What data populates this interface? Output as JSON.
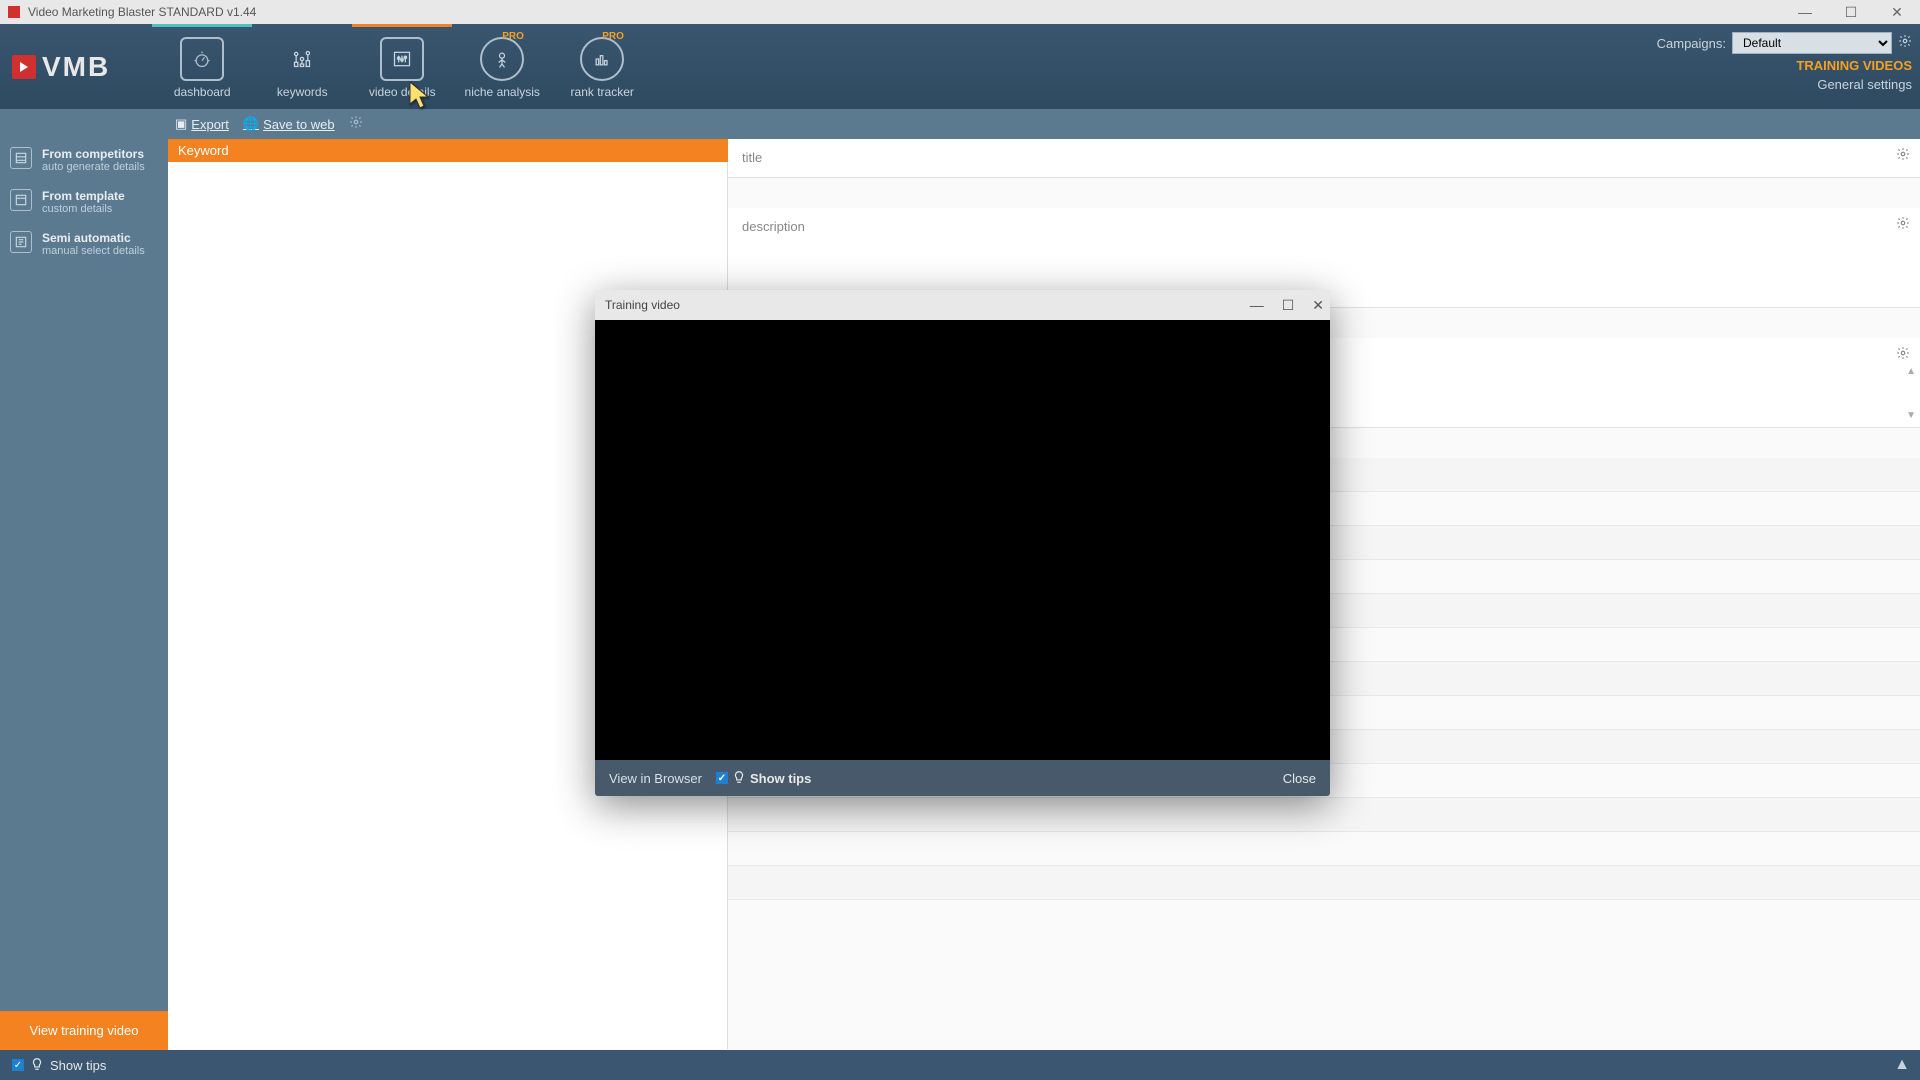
{
  "window": {
    "title": "Video Marketing Blaster STANDARD v1.44"
  },
  "logo": {
    "text": "VMB"
  },
  "nav": {
    "tabs": [
      {
        "label": "dashboard",
        "pro": false
      },
      {
        "label": "keywords",
        "pro": false
      },
      {
        "label": "video details",
        "pro": false
      },
      {
        "label": "niche analysis",
        "pro": true
      },
      {
        "label": "rank tracker",
        "pro": true
      }
    ],
    "pro_badge": "PRO"
  },
  "campaigns": {
    "label": "Campaigns:",
    "selected": "Default"
  },
  "top_links": {
    "training": "TRAINING VIDEOS",
    "settings": "General settings"
  },
  "subtoolbar": {
    "export": "Export",
    "save_web": "Save to web"
  },
  "sidebar": {
    "items": [
      {
        "title": "From competitors",
        "sub": "auto generate details"
      },
      {
        "title": "From template",
        "sub": "custom details"
      },
      {
        "title": "Semi automatic",
        "sub": "manual select details"
      }
    ],
    "view_training": "View training video"
  },
  "keyword_col": {
    "header": "Keyword"
  },
  "fields": {
    "title": "title",
    "description": "description"
  },
  "bottombar": {
    "show_tips": "Show tips"
  },
  "modal": {
    "title": "Training video",
    "view_browser": "View in Browser",
    "show_tips": "Show tips",
    "close": "Close"
  }
}
